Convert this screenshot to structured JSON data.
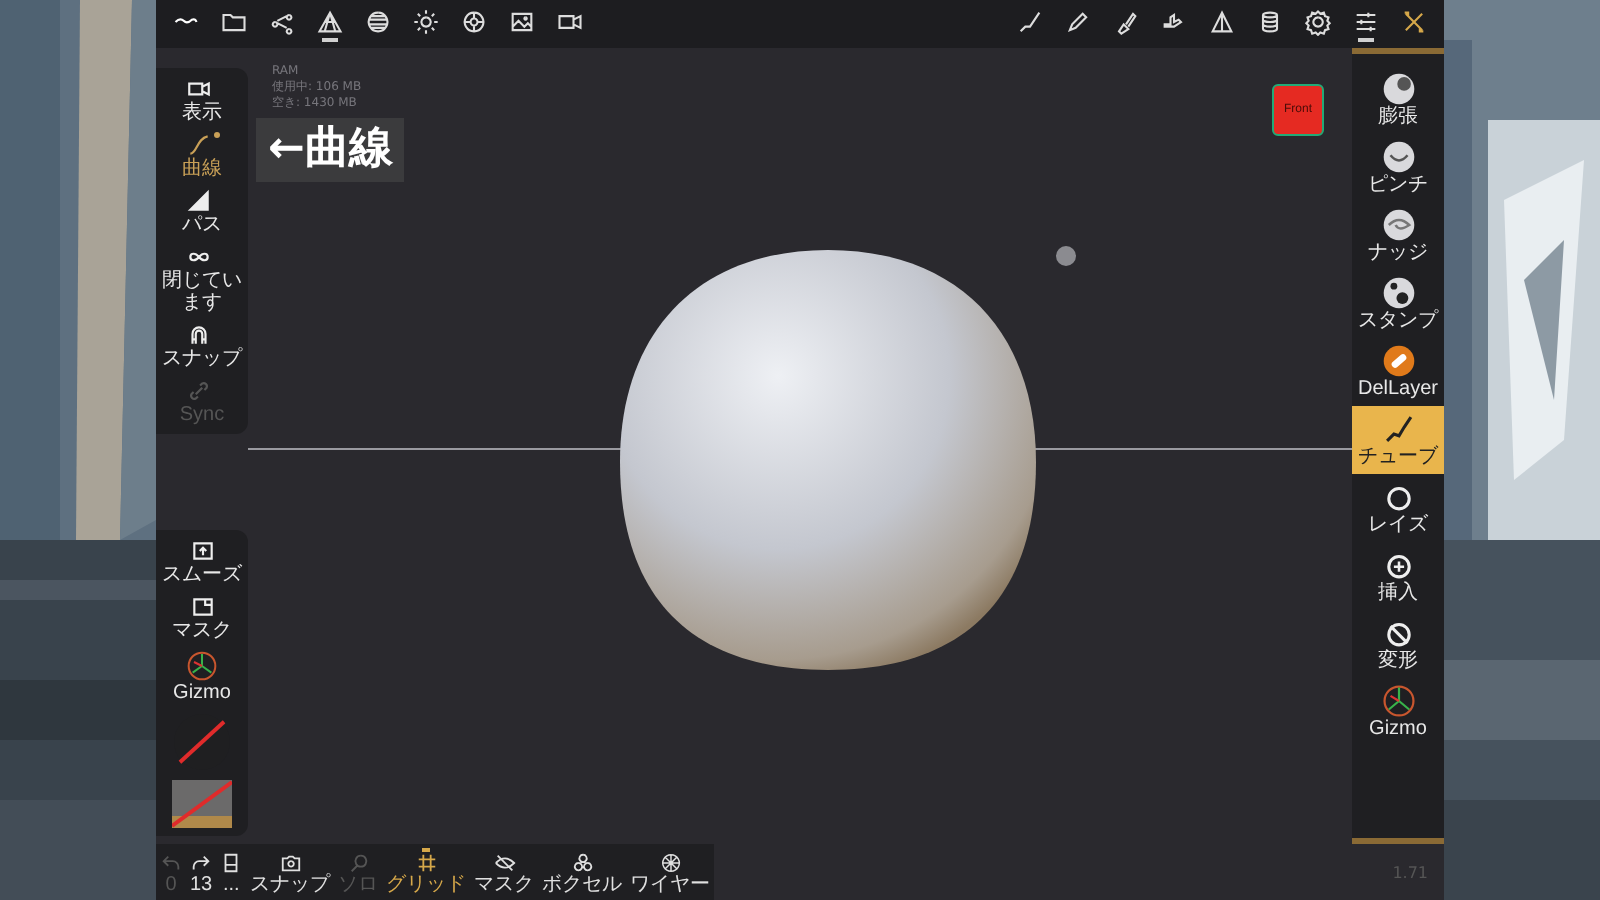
{
  "top_bar": {
    "left_tools": [
      {
        "selected": false
      },
      {
        "selected": false
      },
      {
        "selected": false
      },
      {
        "selected": true
      },
      {
        "selected": false
      },
      {
        "selected": false
      },
      {
        "selected": false
      },
      {
        "selected": false
      },
      {
        "selected": false
      }
    ],
    "right_tools": [
      {
        "selected": false
      },
      {
        "selected": false
      },
      {
        "selected": false
      },
      {
        "selected": false
      },
      {
        "selected": false
      },
      {
        "selected": false
      },
      {
        "selected": false
      },
      {
        "selected": true
      },
      {
        "selected": false
      }
    ]
  },
  "left_panel": [
    {
      "label": "表示",
      "selected": false,
      "disabled": false
    },
    {
      "label": "曲線",
      "selected": true,
      "disabled": false
    },
    {
      "label": "パス",
      "selected": false,
      "disabled": false
    },
    {
      "label": "閉じています",
      "selected": false,
      "disabled": false
    },
    {
      "label": "スナップ",
      "selected": false,
      "disabled": false
    },
    {
      "label": "Sync",
      "selected": false,
      "disabled": true
    }
  ],
  "left_panel_lower": [
    {
      "label": "スムーズ"
    },
    {
      "label": "マスク"
    },
    {
      "label": "Gizmo"
    }
  ],
  "viewport": {
    "ram": [
      "RAM",
      "使用中: 106 MB",
      "空き: 1430 MB"
    ],
    "view_cube": "Front",
    "callout": "←曲線"
  },
  "right_panel": [
    {
      "label": "膨張",
      "selected": false
    },
    {
      "label": "ピンチ",
      "selected": false
    },
    {
      "label": "ナッジ",
      "selected": false
    },
    {
      "label": "スタンプ",
      "selected": false
    },
    {
      "label": "DelLayer",
      "selected": false
    },
    {
      "label": "チューブ",
      "selected": true
    },
    {
      "label": "レイズ",
      "selected": false
    },
    {
      "label": "挿入",
      "selected": false
    },
    {
      "label": "変形",
      "selected": false
    },
    {
      "label": "Gizmo",
      "selected": false
    }
  ],
  "bottom_bar": [
    {
      "label": "0",
      "selected": false,
      "disabled": true
    },
    {
      "label": "13",
      "selected": false,
      "disabled": false
    },
    {
      "label": "...",
      "selected": false,
      "disabled": false
    },
    {
      "label": "スナップ",
      "selected": false,
      "disabled": false
    },
    {
      "label": "ソロ",
      "selected": false,
      "disabled": true
    },
    {
      "label": "グリッド",
      "selected": true,
      "disabled": false
    },
    {
      "label": "マスク",
      "selected": false,
      "disabled": false
    },
    {
      "label": "ボクセル",
      "selected": false,
      "disabled": false
    },
    {
      "label": "ワイヤー",
      "selected": false,
      "disabled": false
    }
  ],
  "version": "1.71"
}
